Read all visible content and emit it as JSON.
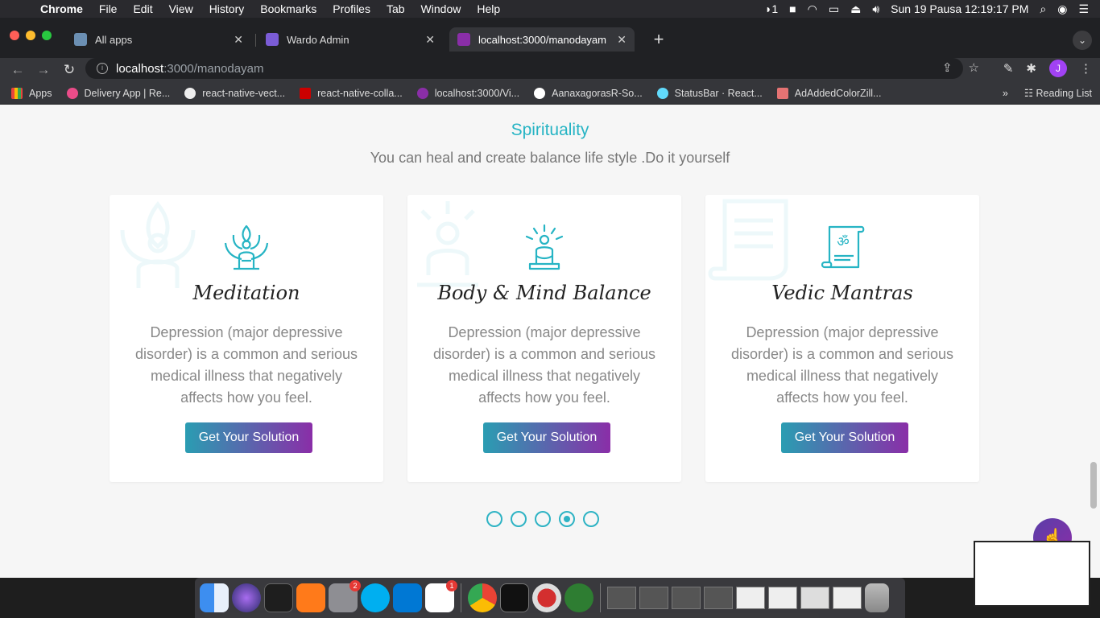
{
  "menubar": {
    "app": "Chrome",
    "items": [
      "File",
      "Edit",
      "View",
      "History",
      "Bookmarks",
      "Profiles",
      "Tab",
      "Window",
      "Help"
    ],
    "indicator": "1",
    "clock": "Sun 19 Pausa  12:19:17 PM"
  },
  "tabs": [
    {
      "title": "All apps",
      "active": false
    },
    {
      "title": "Wardo Admin",
      "active": false
    },
    {
      "title": "localhost:3000/manodayam",
      "active": true
    }
  ],
  "address": {
    "host": "localhost",
    "path": ":3000/manodayam"
  },
  "avatar_initial": "J",
  "bookmarks": {
    "items": [
      "Apps",
      "Delivery App | Re...",
      "react-native-vect...",
      "react-native-colla...",
      "localhost:3000/Vi...",
      "AanaxagorasR-So...",
      "StatusBar · React...",
      "AdAddedColorZill..."
    ],
    "reading_list": "Reading List"
  },
  "section": {
    "title": "Spirituality",
    "subtitle": "You can heal and create balance life style .Do it yourself"
  },
  "cards": [
    {
      "title": "Meditation",
      "desc": "Depression (major depressive disorder) is a common and serious medical illness that negatively affects how you feel.",
      "button": "Get Your Solution"
    },
    {
      "title": "Body & Mind Balance",
      "desc": "Depression (major depressive disorder) is a common and serious medical illness that negatively affects how you feel.",
      "button": "Get Your Solution"
    },
    {
      "title": "Vedic Mantras",
      "desc": "Depression (major depressive disorder) is a common and serious medical illness that negatively affects how you feel.",
      "button": "Get Your Solution"
    }
  ],
  "carousel": {
    "count": 5,
    "active_index": 3
  },
  "dock_badges": {
    "settings": "2",
    "mail": "1"
  },
  "colors": {
    "accent": "#26b4c4",
    "button_from": "#2a9db2",
    "button_to": "#8a2ea8"
  }
}
